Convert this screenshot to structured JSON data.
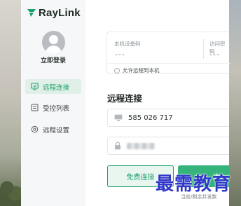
{
  "brand": {
    "name": "RayLink"
  },
  "sidebar": {
    "login_label": "立即登录",
    "items": [
      {
        "label": "远程连接",
        "icon": "remote-connect-icon",
        "active": true
      },
      {
        "label": "受控列表",
        "icon": "list-icon",
        "active": false
      },
      {
        "label": "远程设置",
        "icon": "settings-icon",
        "active": false
      }
    ]
  },
  "device_card": {
    "device_code_label": "本机设备码",
    "device_code_value": "---",
    "access_password_label": "访问密码",
    "access_password_value": "---",
    "allow_remote_label": "允许远程到本机"
  },
  "remote": {
    "title": "远程连接",
    "device_id_value": "585 026 717",
    "password_value": "",
    "free_connect_label": "免费连接",
    "main_connect_label": "连"
  },
  "footer": {
    "partial_text": "当前/剩余并发数"
  },
  "watermark": {
    "text": "最需教育"
  },
  "colors": {
    "accent": "#1aa06a",
    "accent_light": "#34b37a",
    "watermark": "#2f37c9"
  }
}
